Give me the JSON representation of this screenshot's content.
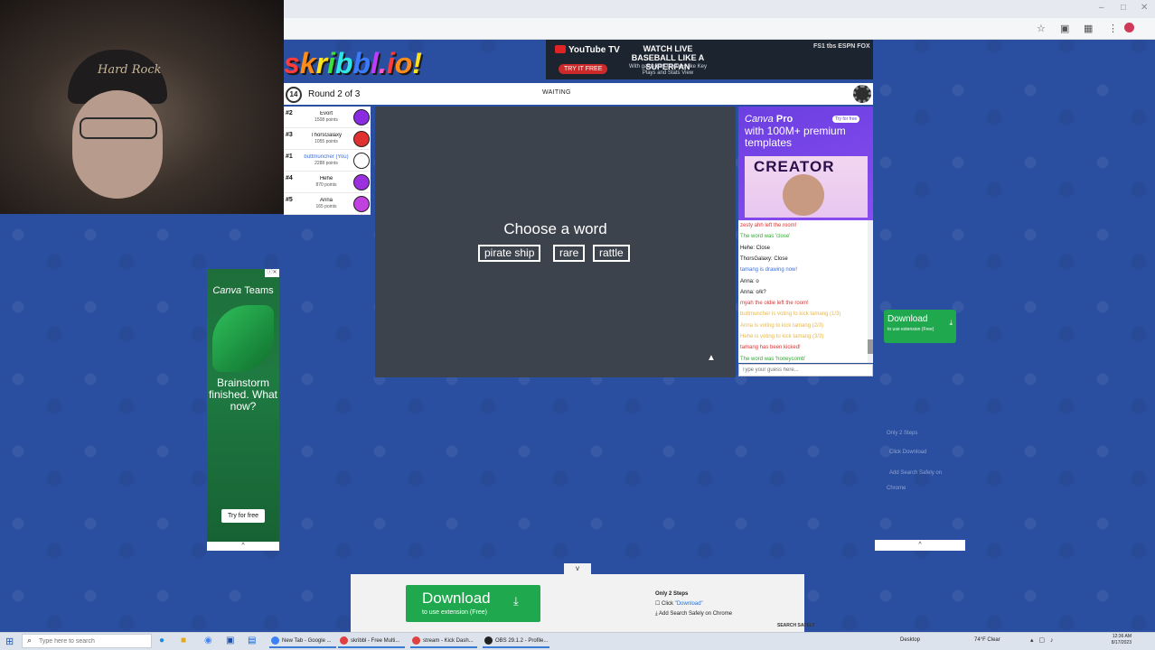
{
  "browser": {
    "window_controls": [
      "–",
      "□",
      "✕"
    ],
    "toolbar_icons": [
      "☆",
      "▣",
      "▦",
      "⋮"
    ]
  },
  "webcam": {
    "cap_text": "Hard Rock"
  },
  "logo": {
    "letters": [
      "s",
      "k",
      "r",
      "i",
      "b",
      "b",
      "l",
      ".",
      "i",
      "o",
      "!"
    ],
    "colors": [
      "#ff3b3b",
      "#ff8c1a",
      "#ffe11a",
      "#3ce03c",
      "#2ee6e6",
      "#3b7bff",
      "#c13bff",
      "#ff55c8",
      "#ff3b3b",
      "#ff8c1a",
      "#ffe11a"
    ]
  },
  "ad_top": {
    "brand": "YouTube TV",
    "headline": "WATCH LIVE BASEBALL LIKE A SUPERFAN",
    "subline": "With game day features like Key Plays and Stats View",
    "cta": "TRY IT FREE",
    "networks": "FS1 tbs ESPN FOX"
  },
  "game": {
    "timer": "14",
    "round": "Round 2 of 3",
    "status": "WAITING",
    "choose_title": "Choose a word",
    "words": [
      "pirate ship",
      "rare",
      "rattle"
    ]
  },
  "players": [
    {
      "rank": "#2",
      "name": "Evort",
      "points": "1508 points",
      "avatar_color": "#8a2be2"
    },
    {
      "rank": "#3",
      "name": "ThorsGalaxy",
      "points": "1055 points",
      "avatar_color": "#e03030"
    },
    {
      "rank": "#1",
      "name": "buttmuncher (You)",
      "points": "2288 points",
      "avatar_color": "#ffffff",
      "is_you": true
    },
    {
      "rank": "#4",
      "name": "Hehe",
      "points": "870 points",
      "avatar_color": "#9b30e0"
    },
    {
      "rank": "#5",
      "name": "Anna",
      "points": "165 points",
      "avatar_color": "#c040e0"
    }
  ],
  "ad_right": {
    "brand": "Canva",
    "brand_suffix": "Pro",
    "tagline": "with 100M+ premium templates",
    "cta": "Try for free",
    "image_text": "CREATOR"
  },
  "chat": [
    {
      "text": "zesty ahh left the room!",
      "color": "#d33"
    },
    {
      "text": "The word was 'close'",
      "color": "#2faa2f"
    },
    {
      "text": "Hehe: Close",
      "color": "#111",
      "bold_prefix": "Hehe:"
    },
    {
      "text": "ThorsGalaxy: Close",
      "color": "#111",
      "bold_prefix": "ThorsGalaxy:"
    },
    {
      "text": "tamang is drawing now!",
      "color": "#3a6fe0"
    },
    {
      "text": "Anna: o",
      "color": "#111",
      "bold_prefix": "Anna:"
    },
    {
      "text": "Anna: o/k?",
      "color": "#111",
      "bold_prefix": "Anna:"
    },
    {
      "text": "myah the oldie left the room!",
      "color": "#d33"
    },
    {
      "text": "buttmuncher is voting to kick tamang (1/3)",
      "color": "#e8b84a"
    },
    {
      "text": "Anna is voting to kick tamang (2/3)",
      "color": "#e8b84a"
    },
    {
      "text": "Hehe is voting to kick tamang (3/3)",
      "color": "#e8b84a"
    },
    {
      "text": "tamang has been kicked!",
      "color": "#d33"
    },
    {
      "text": "The word was 'honeycomb'",
      "color": "#2faa2f"
    }
  ],
  "guess": {
    "placeholder": "Type your guess here..."
  },
  "ad_left": {
    "brand": "Canva",
    "brand_suffix": "Teams",
    "message": "Brainstorm finished. What now?",
    "cta": "Try for free",
    "close": "ⓘ✕"
  },
  "download_right": {
    "title": "Download",
    "subtitle": "to use extension (Free)",
    "faint_steps": [
      "Only 2 Steps",
      "Click Download",
      "Add Search Safely on",
      "Chrome"
    ]
  },
  "download_bottom": {
    "title": "Download",
    "subtitle": "to use extension (Free)",
    "steps_title": "Only 2 Steps",
    "step1_prefix": "Click ",
    "step1_link": "\"Download\"",
    "step2": "Add Search Safely on Chrome",
    "brand": "SEARCH SAFELY"
  },
  "collapse": {
    "up": "^",
    "down": "v"
  },
  "taskbar": {
    "search_placeholder": "Type here to search",
    "tasks": [
      {
        "label": "New Tab - Google ...",
        "color": "#3b82f6"
      },
      {
        "label": "skribbl - Free Multi...",
        "color": "#e04040"
      },
      {
        "label": "stream - Kick Dash...",
        "color": "#e04040"
      },
      {
        "label": "OBS 29.1.2 - Profile...",
        "color": "#222"
      }
    ],
    "desktop": "Desktop",
    "weather": "74°F Clear",
    "time": "12:36 AM",
    "date": "8/17/2023"
  }
}
